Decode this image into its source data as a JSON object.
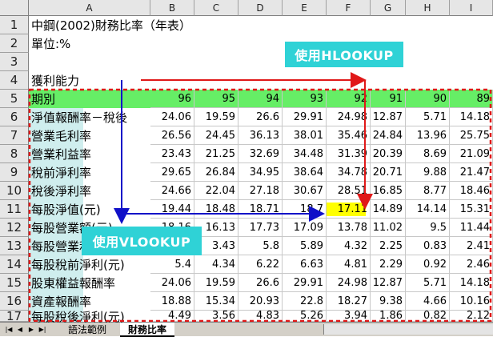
{
  "columns": [
    "A",
    "B",
    "C",
    "D",
    "E",
    "F",
    "G",
    "H",
    "I"
  ],
  "rows": [
    "1",
    "2",
    "3",
    "4",
    "5",
    "6",
    "7",
    "8",
    "9",
    "10",
    "11",
    "12",
    "13",
    "14",
    "15",
    "16",
    "17"
  ],
  "cells": {
    "a1": "中鋼(2002)財務比率（年表）",
    "a2": "單位:%",
    "a4": "獲利能力",
    "a5": "期別"
  },
  "years": [
    "96",
    "95",
    "94",
    "93",
    "92",
    "91",
    "90",
    "89"
  ],
  "table": [
    {
      "label": "淨值報酬率－稅後",
      "values": [
        "24.06",
        "19.59",
        "26.6",
        "29.91",
        "24.98",
        "12.87",
        "5.71",
        "14.18"
      ]
    },
    {
      "label": "營業毛利率",
      "values": [
        "26.56",
        "24.45",
        "36.13",
        "38.01",
        "35.46",
        "24.84",
        "13.96",
        "25.75"
      ]
    },
    {
      "label": "營業利益率",
      "values": [
        "23.43",
        "21.25",
        "32.69",
        "34.48",
        "31.39",
        "20.39",
        "8.69",
        "21.09"
      ]
    },
    {
      "label": "稅前淨利率",
      "values": [
        "29.65",
        "26.84",
        "34.95",
        "38.64",
        "34.78",
        "20.71",
        "9.88",
        "21.47"
      ]
    },
    {
      "label": "稅後淨利率",
      "values": [
        "24.66",
        "22.04",
        "27.18",
        "30.67",
        "28.51",
        "16.85",
        "8.77",
        "18.46"
      ]
    },
    {
      "label": "每股淨值(元)",
      "values": [
        "19.44",
        "18.48",
        "18.71",
        "18.7",
        "17.11",
        "14.89",
        "14.14",
        "15.31"
      ]
    },
    {
      "label": "每股營業額(元)",
      "values": [
        "18.16",
        "16.13",
        "17.73",
        "17.09",
        "13.78",
        "11.02",
        "9.5",
        "11.44"
      ]
    },
    {
      "label": "每股營業利益(元)",
      "values": [
        "",
        "3.43",
        "5.8",
        "5.89",
        "4.32",
        "2.25",
        "0.83",
        "2.41"
      ]
    },
    {
      "label": "每股稅前淨利(元)",
      "values": [
        "5.4",
        "4.34",
        "6.22",
        "6.63",
        "4.81",
        "2.29",
        "0.92",
        "2.46"
      ]
    },
    {
      "label": "股東權益報酬率",
      "values": [
        "24.06",
        "19.59",
        "26.6",
        "29.91",
        "24.98",
        "12.87",
        "5.71",
        "14.18"
      ]
    },
    {
      "label": "資產報酬率",
      "values": [
        "18.88",
        "15.34",
        "20.93",
        "22.8",
        "18.27",
        "9.38",
        "4.66",
        "10.16"
      ]
    },
    {
      "label": "每股稅後淨利(元)",
      "values": [
        "4.49",
        "3.56",
        "4.83",
        "5.26",
        "3.94",
        "1.86",
        "0.82",
        "2.12"
      ]
    }
  ],
  "callouts": {
    "hlookup": "使用HLOOKUP",
    "vlookup": "使用VLOOKUP"
  },
  "tabs": {
    "sheet1": "語法範例",
    "sheet2": "財務比率"
  },
  "colors": {
    "header_row": "#66ee66",
    "row_label_bg": "#cfeeee",
    "highlight": "#ffff00",
    "callout": "#2fd2d6",
    "arrow_red": "#e01818",
    "arrow_blue": "#1010c8"
  }
}
